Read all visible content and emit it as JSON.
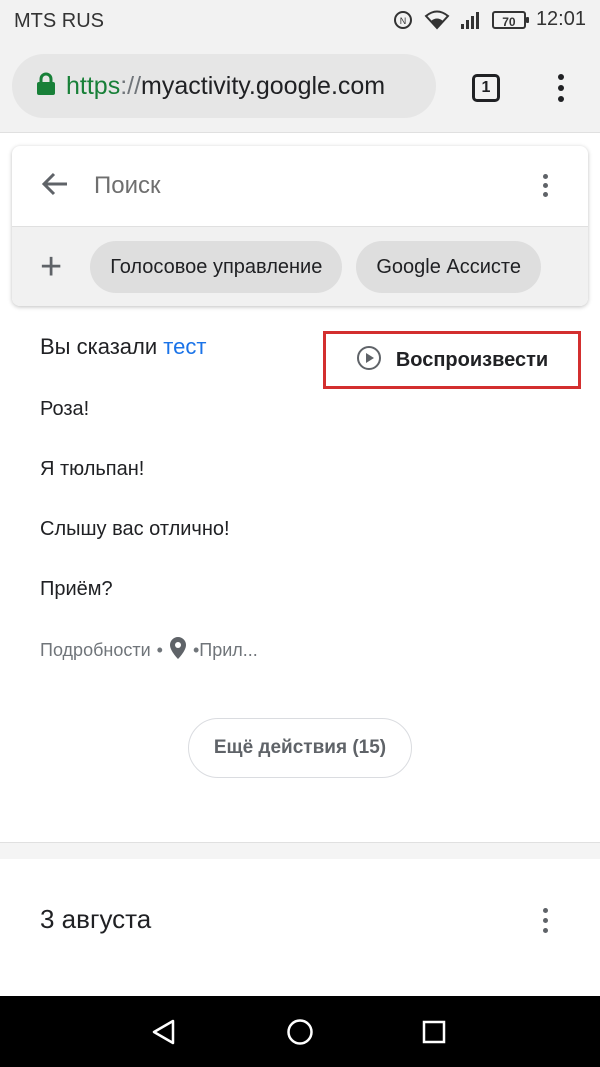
{
  "status_bar": {
    "carrier": "MTS RUS",
    "battery": "70",
    "time": "12:01"
  },
  "browser": {
    "url_scheme": "https",
    "url_separator": "://",
    "url_host": "myactivity.google.com",
    "tabs_count": "1"
  },
  "search": {
    "placeholder": "Поиск"
  },
  "filters": {
    "chips": [
      "Голосовое управление",
      "Google Ассисте"
    ]
  },
  "activity": {
    "said_prefix": "Вы сказали",
    "query": "тест",
    "play_label": "Воспроизвести",
    "lines": [
      "Роза!",
      "Я тюльпан!",
      "Слышу вас отлично!",
      "Приём?"
    ],
    "details_label": "Подробности",
    "bullet": "•",
    "details_tail": "•Прил...",
    "more_label": "Ещё действия (15)"
  },
  "next_section": {
    "date": "3 августа"
  },
  "colors": {
    "highlight_border": "#d32f2f",
    "link_blue": "#1a73e8",
    "lock_green": "#188038"
  },
  "icons": {
    "lock": "lock-icon",
    "back": "arrow-left-icon",
    "play": "play-circle-icon",
    "location": "location-pin-icon"
  }
}
